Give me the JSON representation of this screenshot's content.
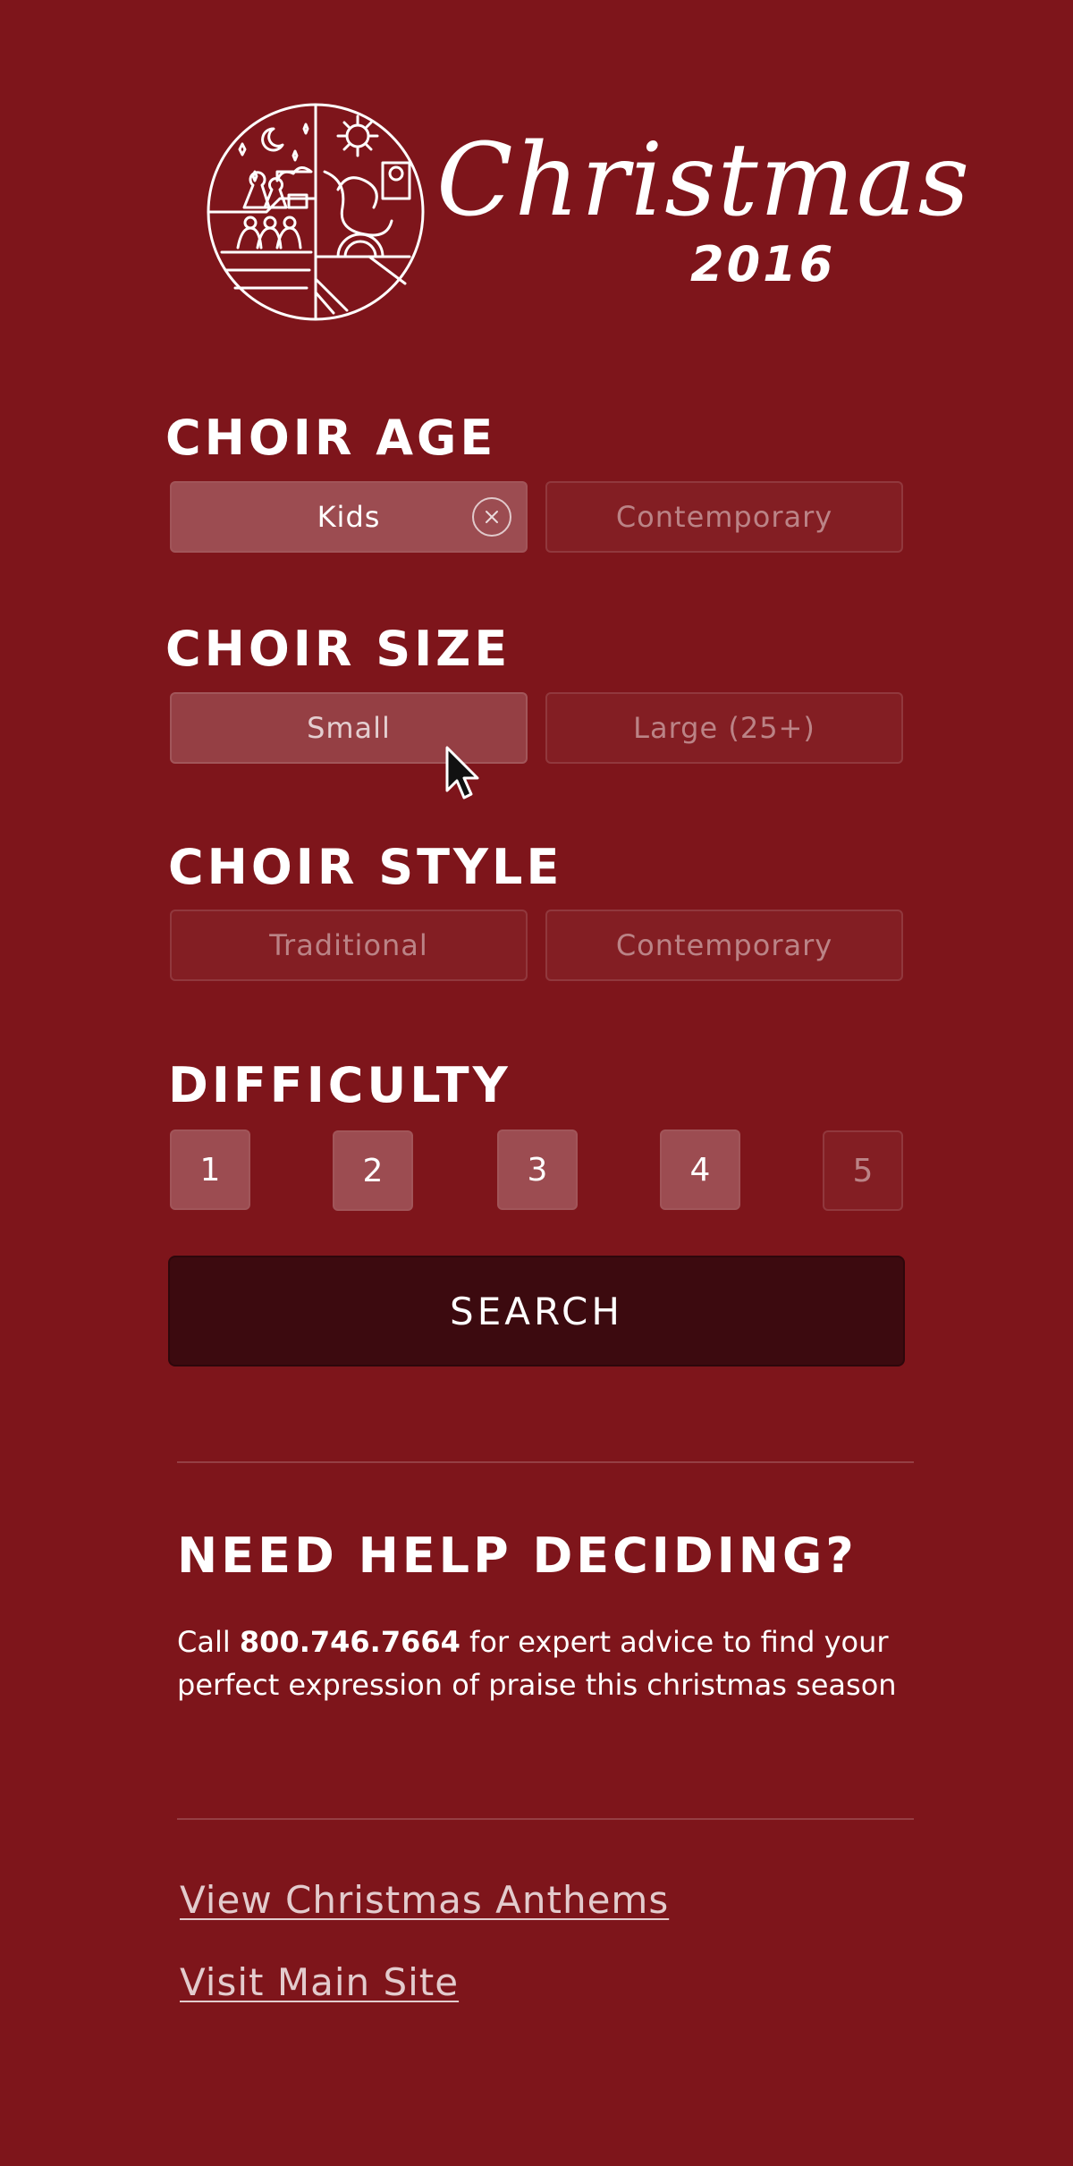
{
  "logo": {
    "wordmark": "Christmas",
    "year": "2016"
  },
  "choir_age": {
    "heading": "CHOIR AGE",
    "options": [
      {
        "label": "Kids",
        "selected": true
      },
      {
        "label": "Contemporary",
        "selected": false
      }
    ]
  },
  "choir_size": {
    "heading": "CHOIR SIZE",
    "options": [
      {
        "label": "Small",
        "selected": false
      },
      {
        "label": "Large (25+)",
        "selected": false
      }
    ]
  },
  "choir_style": {
    "heading": "CHOIR STYLE",
    "options": [
      {
        "label": "Traditional",
        "selected": false
      },
      {
        "label": "Contemporary",
        "selected": false
      }
    ]
  },
  "difficulty": {
    "heading": "DIFFICULTY",
    "levels": [
      {
        "label": "1",
        "selected": true
      },
      {
        "label": "2",
        "selected": true
      },
      {
        "label": "3",
        "selected": true
      },
      {
        "label": "4",
        "selected": true
      },
      {
        "label": "5",
        "selected": false
      }
    ]
  },
  "search_label": "SEARCH",
  "help": {
    "title": "NEED HELP DECIDING?",
    "text_before": "Call ",
    "phone": "800.746.7664",
    "text_after": " for expert advice to find your perfect expression of praise this christmas season"
  },
  "links": {
    "anthems": "View Christmas Anthems",
    "main_site": "Visit Main Site"
  },
  "icons": {
    "logo": "nativity-emblem-icon",
    "clear": "close-circle-icon",
    "cursor": "mouse-pointer-icon"
  },
  "colors": {
    "background": "#7e151b",
    "search_button": "#3c0a0f",
    "text": "#ffffff"
  }
}
